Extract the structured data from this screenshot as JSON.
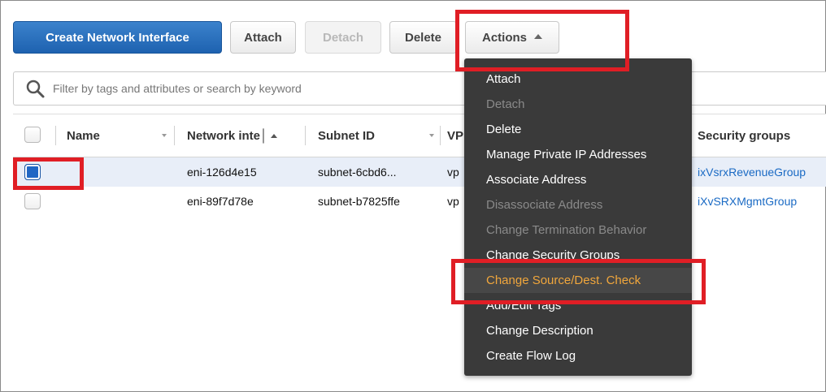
{
  "toolbar": {
    "create_label": "Create Network Interface",
    "attach_label": "Attach",
    "detach_label": "Detach",
    "delete_label": "Delete",
    "actions_label": "Actions"
  },
  "search": {
    "placeholder": "Filter by tags and attributes or search by keyword"
  },
  "table": {
    "columns": [
      "Name",
      "Network inte│",
      "Subnet ID",
      "VP",
      "Security groups"
    ],
    "rows": [
      {
        "interface_id": "eni-126d4e15",
        "subnet_id": "subnet-6cbd6...",
        "vpc": "vp",
        "security_group": "ixVsrxRevenueGroup",
        "selected": true
      },
      {
        "interface_id": "eni-89f7d78e",
        "subnet_id": "subnet-b7825ffe",
        "vpc": "vp",
        "security_group": "iXvSRXMgmtGroup",
        "selected": false
      }
    ]
  },
  "actions_menu": {
    "items": [
      "Attach",
      "Detach",
      "Delete",
      "Manage Private IP Addresses",
      "Associate Address",
      "Disassociate Address",
      "Change Termination Behavior",
      "Change Security Groups",
      "Change Source/Dest. Check",
      "Add/Edit Tags",
      "Change Description",
      "Create Flow Log"
    ],
    "disabled": [
      "Detach",
      "Disassociate Address",
      "Change Termination Behavior"
    ],
    "highlighted": "Change Source/Dest. Check"
  },
  "colors": {
    "primary": "#1e62b0",
    "highlight_text": "#f0a63c",
    "annotation": "#e01e25",
    "link": "#1a6ac4"
  }
}
